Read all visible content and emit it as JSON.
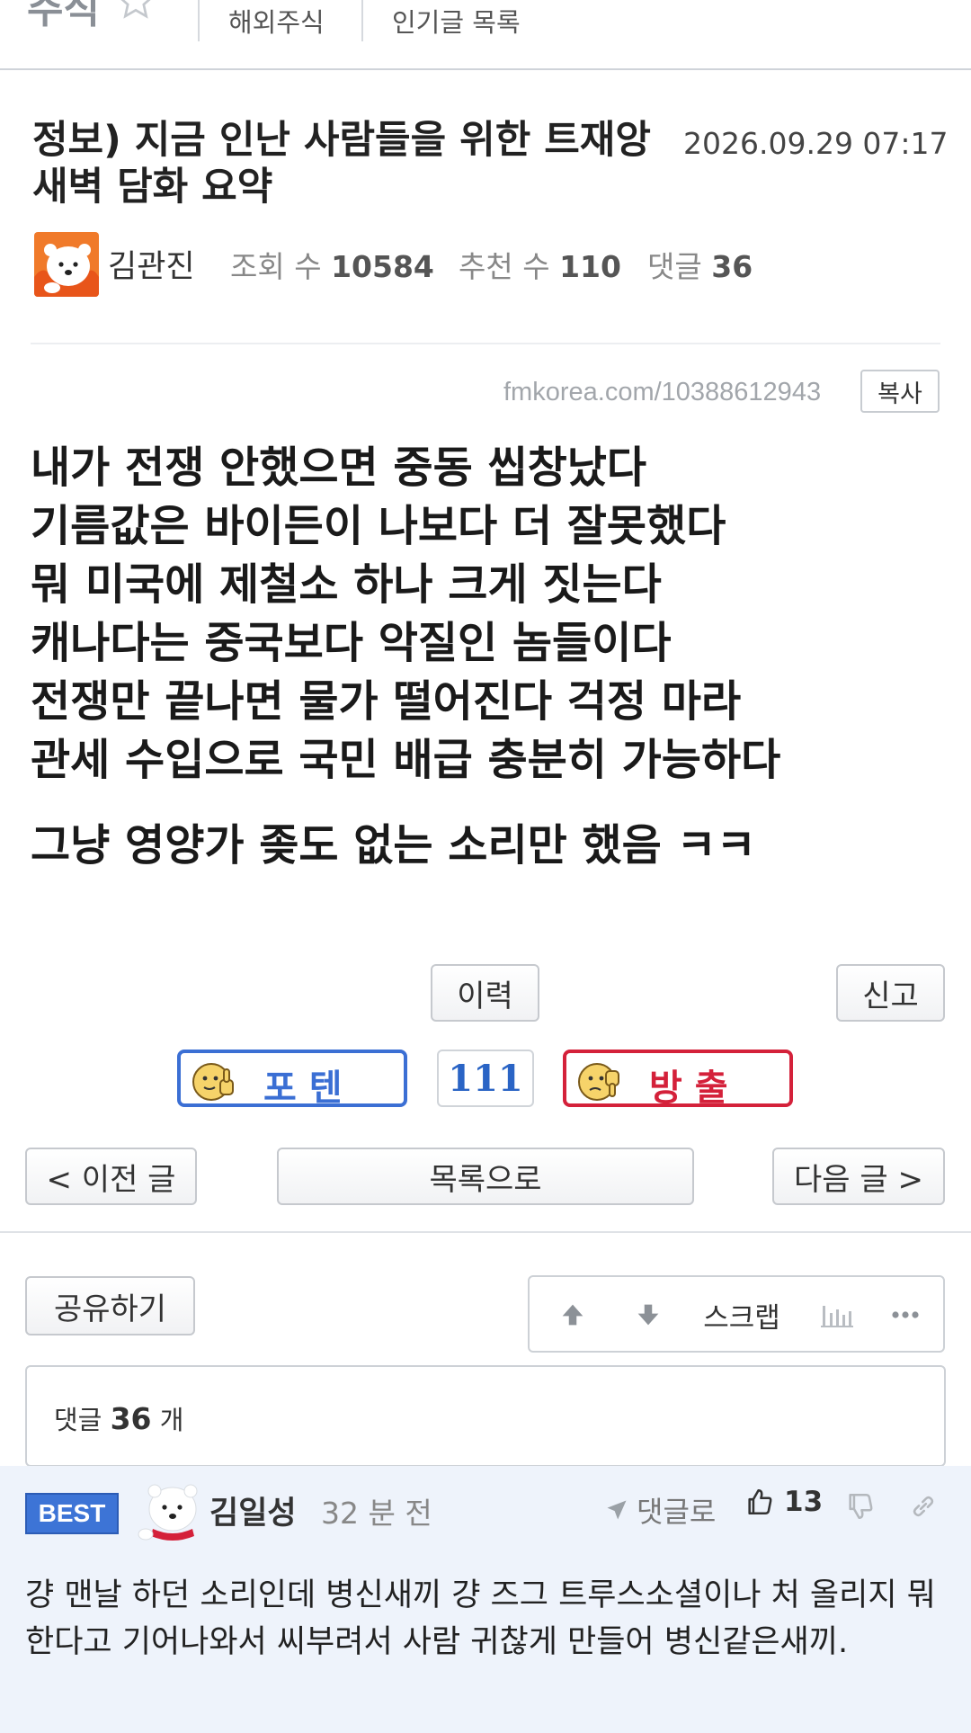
{
  "nav": {
    "board_name": "주식",
    "links": [
      "해외주식",
      "인기글 목록"
    ]
  },
  "post": {
    "title": "정보) 지금 인난 사람들을 위한 트재앙 새벽 담화 요약",
    "date": "2026.09.29 07:17",
    "author": "김관진",
    "views_label": "조회 수",
    "views": "10584",
    "recommend_label": "추천 수",
    "recommend": "110",
    "comments_label": "댓글",
    "comments": "36",
    "url": "fmkorea.com/10388612943",
    "copy_label": "복사",
    "lines": [
      "내가 전쟁 안했으면 중동 씹창났다",
      "기름값은 바이든이 나보다 더 잘못했다",
      "뭐 미국에 제철소 하나 크게 짓는다",
      "캐나다는 중국보다 악질인 놈들이다",
      "전쟁만 끝나면 물가 떨어진다 걱정 마라",
      "관세 수입으로 국민 배급 충분히 가능하다"
    ],
    "closing_line": "그냥 영양가 좆도 없는 소리만 했음 ㅋㅋ"
  },
  "actions": {
    "history_label": "이력",
    "report_label": "신고",
    "upvote_label": "포 텐",
    "vote_count": "111",
    "downvote_label": "방 출",
    "prev_label": "< 이전 글",
    "list_label": "목록으로",
    "next_label": "다음 글 >",
    "share_label": "공유하기",
    "scrap_label": "스크랩"
  },
  "comments": {
    "count_label": "댓글",
    "count": "36",
    "count_suffix": "개",
    "best": {
      "badge": "BEST",
      "author": "김일성",
      "time": "32 분 전",
      "reply_label": "댓글로",
      "likes": "13",
      "text": "걍 맨날 하던 소리인데 병신새끼 걍 즈그 트루스소셜이나 처 올리지 뭐한다고 기어나와서 씨부려서 사람 귀찮게 만들어 병신같은새끼."
    }
  },
  "colors": {
    "upvote": "#3b6fd4",
    "downvote": "#d4213a",
    "best_badge": "#3d74d6",
    "comment_bg": "#eef3fb"
  }
}
